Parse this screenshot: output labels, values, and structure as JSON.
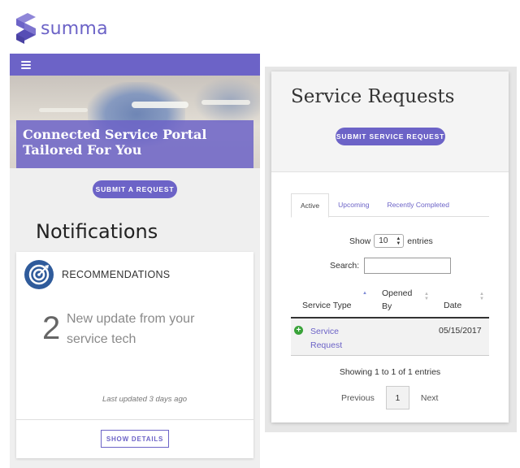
{
  "brand": {
    "name": "summa",
    "color": "#6c63c7"
  },
  "left": {
    "hero_title": "Connected Service Portal Tailored For You",
    "submit_button": "SUBMIT A REQUEST",
    "notifications_title": "Notifications",
    "card": {
      "label": "RECOMMENDATIONS",
      "count": "2",
      "message": "New update from your service tech",
      "last_updated": "Last updated 3 days ago",
      "details_button": "SHOW DETAILS"
    }
  },
  "right": {
    "title": "Service Requests",
    "submit_button": "SUBMIT SERVICE REQUEST",
    "tabs": [
      "Active",
      "Upcoming",
      "Recently Completed"
    ],
    "show_label": "Show",
    "entries_value": "10",
    "entries_label": "entries",
    "search_label": "Search:",
    "search_value": "",
    "table": {
      "headers": [
        "Service Type",
        "Opened By",
        "Date"
      ],
      "rows": [
        {
          "service_type": "Service Request",
          "opened_by": "",
          "date": "05/15/2017"
        }
      ]
    },
    "showing": "Showing 1 to 1 of 1 entries",
    "pager": {
      "previous": "Previous",
      "page": "1",
      "next": "Next"
    }
  },
  "icons": {
    "menu": "hamburger-icon",
    "recommendations": "target-icon",
    "row_expand": "plus-circle-icon",
    "sort": "sort-arrows-icon"
  }
}
